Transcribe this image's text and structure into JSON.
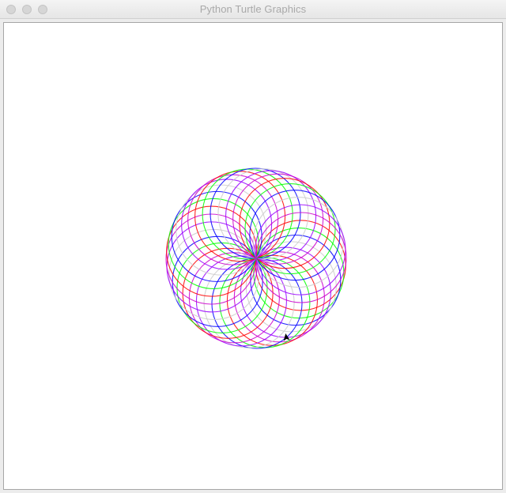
{
  "window": {
    "title": "Python Turtle Graphics"
  },
  "canvas": {
    "background": "#ffffff",
    "spirograph": {
      "ring_count": 36,
      "colors": [
        "#ff0000",
        "#00ff00",
        "#0000ff",
        "#cccccc",
        "#9900ff",
        "#cc00cc"
      ],
      "description_colors": [
        "red",
        "green",
        "blue",
        "silver",
        "purple",
        "magenta"
      ]
    },
    "turtle": {
      "color": "#000000",
      "shape": "arrow-icon"
    }
  }
}
